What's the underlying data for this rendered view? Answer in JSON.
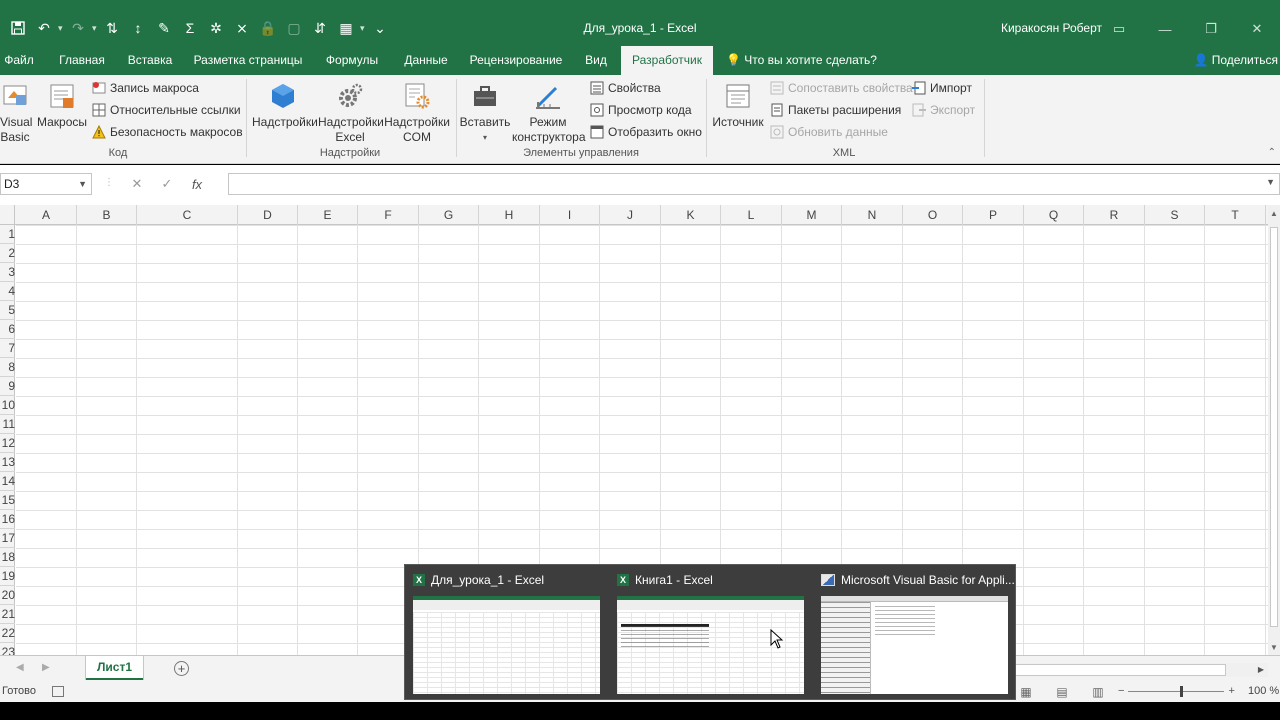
{
  "window": {
    "title": "Для_урока_1  -  Excel",
    "user": "Киракосян Роберт"
  },
  "tabs": [
    {
      "label": "Файл"
    },
    {
      "label": "Главная"
    },
    {
      "label": "Вставка"
    },
    {
      "label": "Разметка страницы"
    },
    {
      "label": "Формулы"
    },
    {
      "label": "Данные"
    },
    {
      "label": "Рецензирование"
    },
    {
      "label": "Вид"
    },
    {
      "label": "Разработчик"
    }
  ],
  "tell_me": "Что вы хотите сделать?",
  "share": "Поделиться",
  "ribbon": {
    "code": {
      "visual_basic_1": "Visual",
      "visual_basic_2": "Basic",
      "macros": "Макросы",
      "record_macro": "Запись макроса",
      "relative_refs": "Относительные ссылки",
      "macro_security": "Безопасность макросов",
      "label": "Код"
    },
    "addins": {
      "addins": "Надстройки",
      "excel_addins_1": "Надстройки",
      "excel_addins_2": "Excel",
      "com_addins_1": "Надстройки",
      "com_addins_2": "COM",
      "label": "Надстройки"
    },
    "controls": {
      "insert": "Вставить",
      "design_mode_1": "Режим",
      "design_mode_2": "конструктора",
      "properties": "Свойства",
      "view_code": "Просмотр кода",
      "run_dialog": "Отобразить окно",
      "label": "Элементы управления"
    },
    "xml": {
      "source": "Источник",
      "map_properties": "Сопоставить свойства",
      "expansion_packs": "Пакеты расширения",
      "refresh_data": "Обновить данные",
      "import": "Импорт",
      "export": "Экспорт",
      "label": "XML"
    }
  },
  "formula_bar": {
    "name_box": "D3",
    "fx": "fx",
    "value": ""
  },
  "columns": [
    "A",
    "B",
    "C",
    "D",
    "E",
    "F",
    "G",
    "H",
    "I",
    "J",
    "K",
    "L",
    "M",
    "N",
    "O",
    "P",
    "Q",
    "R",
    "S",
    "T"
  ],
  "rows": [
    "1",
    "2",
    "3",
    "4",
    "5",
    "6",
    "7",
    "8",
    "9",
    "10",
    "11",
    "12",
    "13",
    "14",
    "15",
    "16",
    "17",
    "18",
    "19",
    "20",
    "21",
    "22",
    "23"
  ],
  "sheet_tab": "Лист1",
  "status": {
    "ready": "Готово",
    "zoom": "100 %"
  },
  "taskbar_preview": [
    {
      "title": "Для_урока_1 - Excel",
      "icon": "excel-icon"
    },
    {
      "title": "Книга1 - Excel",
      "icon": "excel-icon"
    },
    {
      "title": "Microsoft Visual Basic for Appli...",
      "icon": "vba-icon"
    }
  ],
  "colors": {
    "accent": "#217346"
  }
}
